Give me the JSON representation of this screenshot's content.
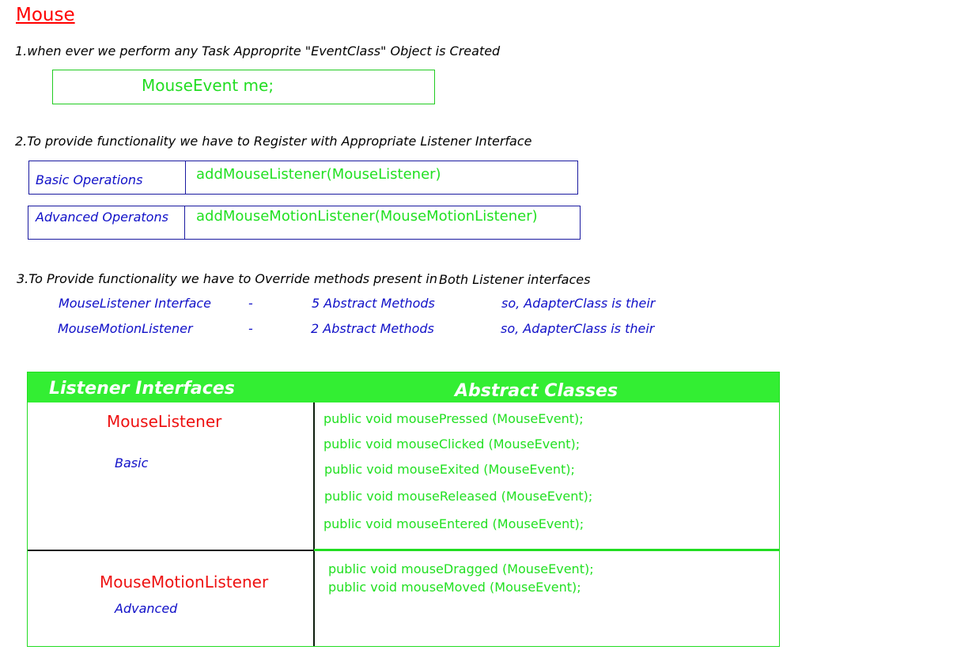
{
  "title": "Mouse",
  "step1": {
    "text": "1.when ever we perform any Task Approprite \"EventClass\" Object is Created",
    "code": "MouseEvent me;"
  },
  "step2": {
    "text": "2.To provide functionality we have to Register with Appropriate Listener Interface",
    "rows": [
      {
        "label": "Basic Operations",
        "method": "addMouseListener(MouseListener)"
      },
      {
        "label": "Advanced Operatons",
        "method": "addMouseMotionListener(MouseMotionListener)"
      }
    ]
  },
  "step3": {
    "text": "3.To Provide functionality we have to Override methods present in",
    "text_suffix": "Both Listener interfaces",
    "lines": [
      {
        "name": "MouseListener Interface",
        "dash": "-",
        "count": "5 Abstract Methods",
        "note": "so, AdapterClass is their"
      },
      {
        "name": "MouseMotionListener",
        "dash": "-",
        "count": "2 Abstract Methods",
        "note": "so, AdapterClass is their"
      }
    ]
  },
  "table": {
    "headers": [
      "Listener Interfaces",
      "Abstract Classes"
    ],
    "rows": [
      {
        "interface": "MouseListener",
        "kind": "Basic",
        "methods": [
          "public void mousePressed (MouseEvent);",
          "public void mouseClicked (MouseEvent);",
          "public void mouseExited (MouseEvent);",
          "public void mouseReleased (MouseEvent);",
          "public void mouseEntered (MouseEvent);"
        ]
      },
      {
        "interface": "MouseMotionListener",
        "kind": "Advanced",
        "methods": [
          "public void mouseDragged (MouseEvent);",
          "public void mouseMoved (MouseEvent);"
        ]
      }
    ]
  },
  "colors": {
    "title": "#ff0000",
    "green": "#22e022",
    "blue": "#1010c8",
    "header_bg": "#33ee33"
  }
}
